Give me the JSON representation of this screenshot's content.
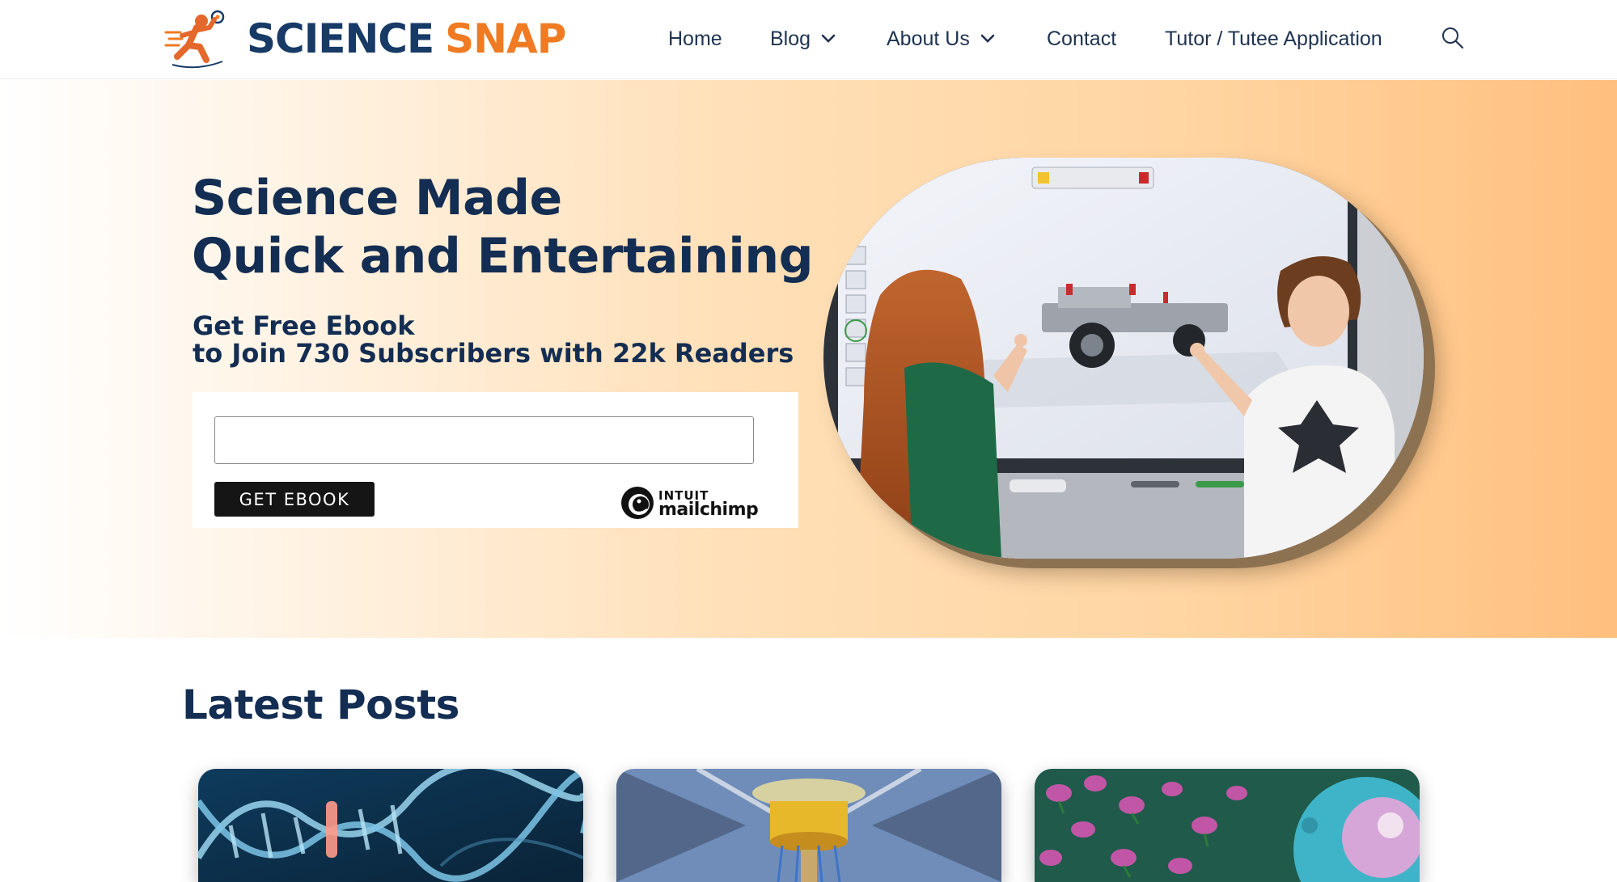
{
  "brand": {
    "word1": "SCIENCE",
    "word2": "SNAP",
    "primary_color": "#173a66",
    "accent_color": "#f07b22"
  },
  "nav": {
    "items": [
      {
        "label": "Home",
        "dropdown": false
      },
      {
        "label": "Blog",
        "dropdown": true
      },
      {
        "label": "About Us",
        "dropdown": true
      },
      {
        "label": "Contact",
        "dropdown": false
      },
      {
        "label": "Tutor / Tutee Application",
        "dropdown": false
      }
    ],
    "search_icon": "search-icon"
  },
  "hero": {
    "title_line1": "Science Made",
    "title_line2": "Quick and Entertaining",
    "subtitle_line1": "Get Free Ebook",
    "subtitle_line2": "to Join 730 Subscribers with 22k Readers",
    "email_value": "",
    "button_label": "GET EBOOK",
    "badge_line1": "INTUIT",
    "badge_line2": "mailchimp"
  },
  "posts": {
    "section_title": "Latest Posts",
    "cards": [
      {
        "image": "dna-helix-image"
      },
      {
        "image": "quantum-computer-image"
      },
      {
        "image": "rose-buds-petri-dish-image"
      }
    ]
  }
}
